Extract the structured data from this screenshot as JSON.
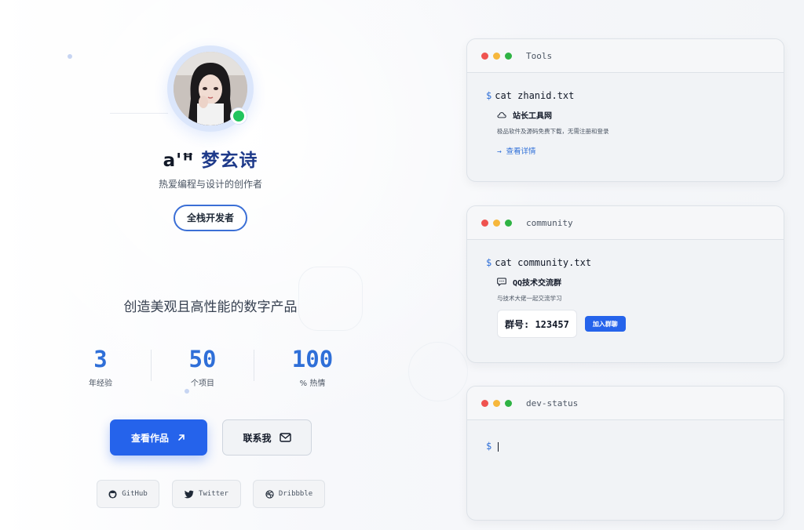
{
  "profile": {
    "name_prefix": "a'ꟸ",
    "name": "梦玄诗",
    "subtitle": "热爱编程与设计的创作者",
    "role_badge": "全栈开发者",
    "tagline": "创造美观且高性能的数字产品"
  },
  "stats": [
    {
      "value": "3",
      "label": "年经验"
    },
    {
      "value": "50",
      "label": "个项目"
    },
    {
      "value": "100",
      "label": "% 热情"
    }
  ],
  "actions": {
    "primary_label": "查看作品",
    "secondary_label": "联系我"
  },
  "social": [
    {
      "label": "GitHub",
      "icon": "github-icon"
    },
    {
      "label": "Twitter",
      "icon": "twitter-icon"
    },
    {
      "label": "Dribbble",
      "icon": "dribbble-icon"
    }
  ],
  "terminals": {
    "tools": {
      "title": "Tools",
      "prompt": "$",
      "command": "cat zhanid.txt",
      "heading": "站长工具网",
      "description": "极品软件及源码免费下载，无需注册和登录",
      "link": "→ 查看详情"
    },
    "community": {
      "title": "community",
      "prompt": "$",
      "command": "cat community.txt",
      "heading": "QQ技术交流群",
      "description": "与技术大佬一起交流学习",
      "group_number": "群号: 123457",
      "join_label": "加入群聊"
    },
    "status": {
      "title": "dev-status",
      "prompt": "$"
    }
  },
  "colors": {
    "accent": "#2563eb",
    "traffic_red": "#ef5350",
    "traffic_yellow": "#f6b73c",
    "traffic_green": "#2fb344",
    "online": "#22c55e"
  }
}
